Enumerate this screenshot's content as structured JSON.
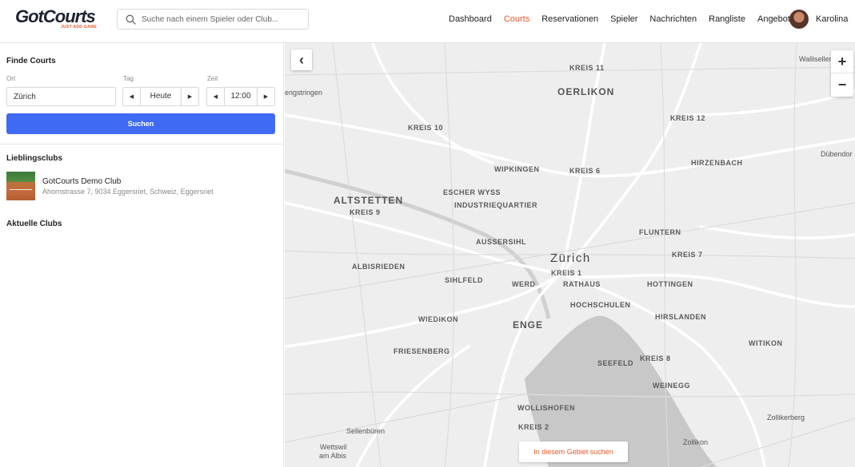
{
  "header": {
    "logo_text": "GotCourts",
    "logo_tagline": "JUST ADD GAME",
    "search_placeholder": "Suche nach einem Spieler oder Club...",
    "nav": [
      {
        "label": "Dashboard",
        "active": false
      },
      {
        "label": "Courts",
        "active": true
      },
      {
        "label": "Reservationen",
        "active": false
      },
      {
        "label": "Spieler",
        "active": false
      },
      {
        "label": "Nachrichten",
        "active": false
      },
      {
        "label": "Rangliste",
        "active": false
      },
      {
        "label": "Angebote",
        "active": false
      }
    ],
    "user_name": "Karolina"
  },
  "sidebar": {
    "find_title": "Finde Courts",
    "ort_label": "Ort",
    "ort_value": "Zürich",
    "tag_label": "Tag",
    "tag_value": "Heute",
    "zeit_label": "Zeit",
    "zeit_value": "12:00",
    "search_button": "Suchen",
    "favorites_title": "Lieblingsclubs",
    "favorite_club": {
      "name": "GotCourts Demo Club",
      "address": "Ahornstrasse 7, 9034 Eggersriet, Schweiz, Eggersriet"
    },
    "current_title": "Aktuelle Clubs"
  },
  "map": {
    "city_label": "Zürich",
    "search_area_button": "In diesem Gebiet suchen",
    "zoom_in": "+",
    "zoom_out": "−",
    "collapse": "‹",
    "labels": {
      "kreis11": "KREIS 11",
      "oerlikon": "OERLIKON",
      "kreis12": "KREIS 12",
      "wallisellen": "Wallisellen",
      "regensdorf": "engstringen",
      "kreis10": "KREIS 10",
      "duebendorf": "Dübendor",
      "wipkingen": "WIPKINGEN",
      "kreis6": "KREIS 6",
      "hirzenbach": "HIRZENBACH",
      "altstetten": "ALTSTETTEN",
      "escherwyss": "ESCHER WYSS",
      "industriequartier": "INDUSTRIEQUARTIER",
      "kreis9": "KREIS 9",
      "fluntern": "FLUNTERN",
      "aussersihl": "AUSSERSIHL",
      "kreis7": "KREIS 7",
      "albisrieden": "ALBISRIEDEN",
      "kreis1": "KREIS 1",
      "sihlfeld": "SIHLFELD",
      "werd": "WERD",
      "rathaus": "RATHAUS",
      "hottingen": "HOTTINGEN",
      "hochschulen": "HOCHSCHULEN",
      "wiedikon": "WIEDIKON",
      "hirslanden": "HIRSLANDEN",
      "enge": "ENGE",
      "witikon": "WITIKON",
      "friesenberg": "FRIESENBERG",
      "seefeld": "SEEFELD",
      "kreis8": "KREIS 8",
      "weinegg": "WEINEGG",
      "wollishofen": "WOLLISHOFEN",
      "kreis2": "KREIS 2",
      "zollikerberg": "Zollikerberg",
      "sellenbueren": "Sellenbüren",
      "zollikon": "Zollikon",
      "wettswil": "Wettswil",
      "amalbis": "am Albis"
    }
  }
}
